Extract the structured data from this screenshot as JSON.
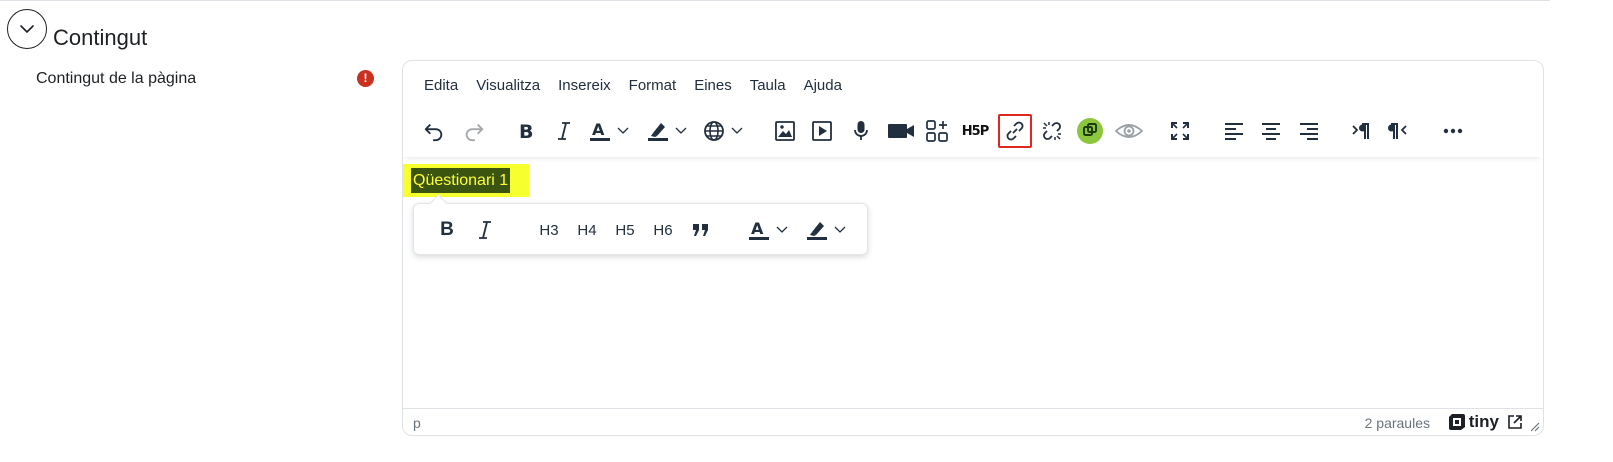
{
  "section": {
    "title": "Contingut"
  },
  "field": {
    "label": "Contingut de la pàgina",
    "required_mark": "!"
  },
  "editor": {
    "menubar": [
      "Edita",
      "Visualitza",
      "Insereix",
      "Format",
      "Eines",
      "Taula",
      "Ajuda"
    ],
    "toolbar": [
      {
        "name": "undo-icon"
      },
      {
        "name": "redo-icon"
      },
      {
        "name": "bold-icon"
      },
      {
        "name": "italic-icon"
      },
      {
        "name": "text-color-icon"
      },
      {
        "name": "highlight-color-icon"
      },
      {
        "name": "language-globe-icon"
      },
      {
        "name": "image-icon"
      },
      {
        "name": "media-icon"
      },
      {
        "name": "microphone-icon"
      },
      {
        "name": "video-camera-icon"
      },
      {
        "name": "content-bank-icon"
      },
      {
        "name": "h5p-icon"
      },
      {
        "name": "link-icon",
        "highlighted": true
      },
      {
        "name": "unlink-icon"
      },
      {
        "name": "autolink-icon"
      },
      {
        "name": "preview-eye-icon"
      },
      {
        "name": "fullscreen-icon"
      },
      {
        "name": "align-left-icon"
      },
      {
        "name": "align-center-icon"
      },
      {
        "name": "align-right-icon"
      },
      {
        "name": "ltr-icon"
      },
      {
        "name": "rtl-icon"
      },
      {
        "name": "more-icon"
      }
    ],
    "content_text": "Qüestionari 1",
    "quickbar": {
      "bold_label": "B",
      "italic_label": "I",
      "h3": "H3",
      "h4": "H4",
      "h5": "H5",
      "h6": "H6",
      "text_color_label": "A"
    },
    "statusbar": {
      "path": "p",
      "word_count": "2 paraules",
      "brand": "tiny"
    },
    "toolbar_text": {
      "text_color_label": "A",
      "h5p_label": "H5P"
    }
  },
  "colors": {
    "required": "#ca3120",
    "selection_bg": "#3b5511",
    "selection_text": "#ffff38",
    "highlight_box": "#f7ff2e",
    "active_outline": "#e0261d",
    "autolink_green": "#8cc63f"
  }
}
